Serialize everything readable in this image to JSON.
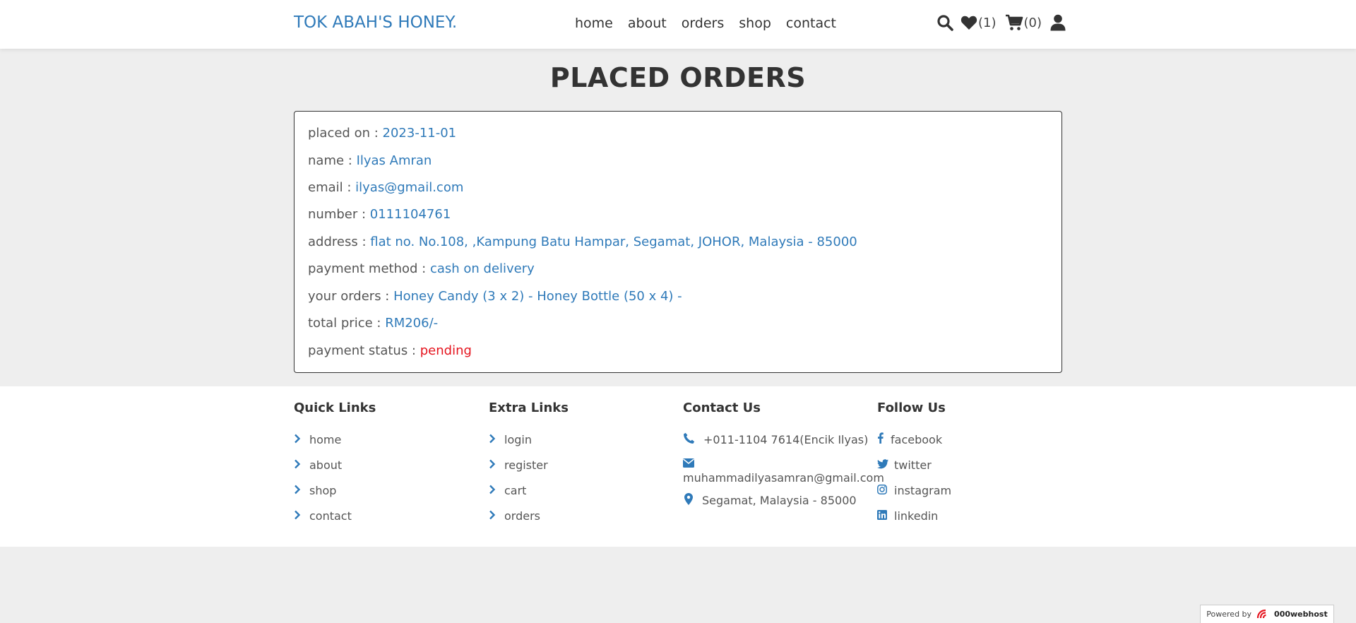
{
  "header": {
    "logo": "TOK ABAH'S HONEY.",
    "nav": [
      "home",
      "about",
      "orders",
      "shop",
      "contact"
    ],
    "wishlist_count": "(1)",
    "cart_count": "(0)"
  },
  "page_title": "PLACED ORDERS",
  "order": {
    "placed_on": {
      "label": "placed on : ",
      "value": "2023-11-01"
    },
    "name": {
      "label": "name : ",
      "value": "Ilyas Amran"
    },
    "email": {
      "label": "email : ",
      "value": "ilyas@gmail.com"
    },
    "number": {
      "label": "number : ",
      "value": "0111104761"
    },
    "address": {
      "label": "address : ",
      "value": "flat no. No.108, ,Kampung Batu Hampar, Segamat, JOHOR, Malaysia - 85000"
    },
    "payment_method": {
      "label": "payment method : ",
      "value": "cash on delivery"
    },
    "your_orders": {
      "label": "your orders : ",
      "value": "Honey Candy (3 x 2) - Honey Bottle (50 x 4) -"
    },
    "total_price": {
      "label": "total price : ",
      "value": "RM206/-"
    },
    "payment_status": {
      "label": "payment status : ",
      "value": "pending"
    }
  },
  "footer": {
    "quick_links": {
      "title": "Quick Links",
      "items": [
        "home",
        "about",
        "shop",
        "contact"
      ]
    },
    "extra_links": {
      "title": "Extra Links",
      "items": [
        "login",
        "register",
        "cart",
        "orders"
      ]
    },
    "contact": {
      "title": "Contact Us",
      "phone": "+011-1104 7614(Encik Ilyas)",
      "email": "muhammadilyasamran@gmail.com",
      "location": "Segamat, Malaysia - 85000"
    },
    "follow": {
      "title": "Follow Us",
      "items": [
        "facebook",
        "twitter",
        "instagram",
        "linkedin"
      ]
    }
  },
  "badge": {
    "powered": "Powered by",
    "brand": "000webhost"
  },
  "colors": {
    "accent": "#2f7ab9",
    "status_pending": "#e5141e"
  }
}
